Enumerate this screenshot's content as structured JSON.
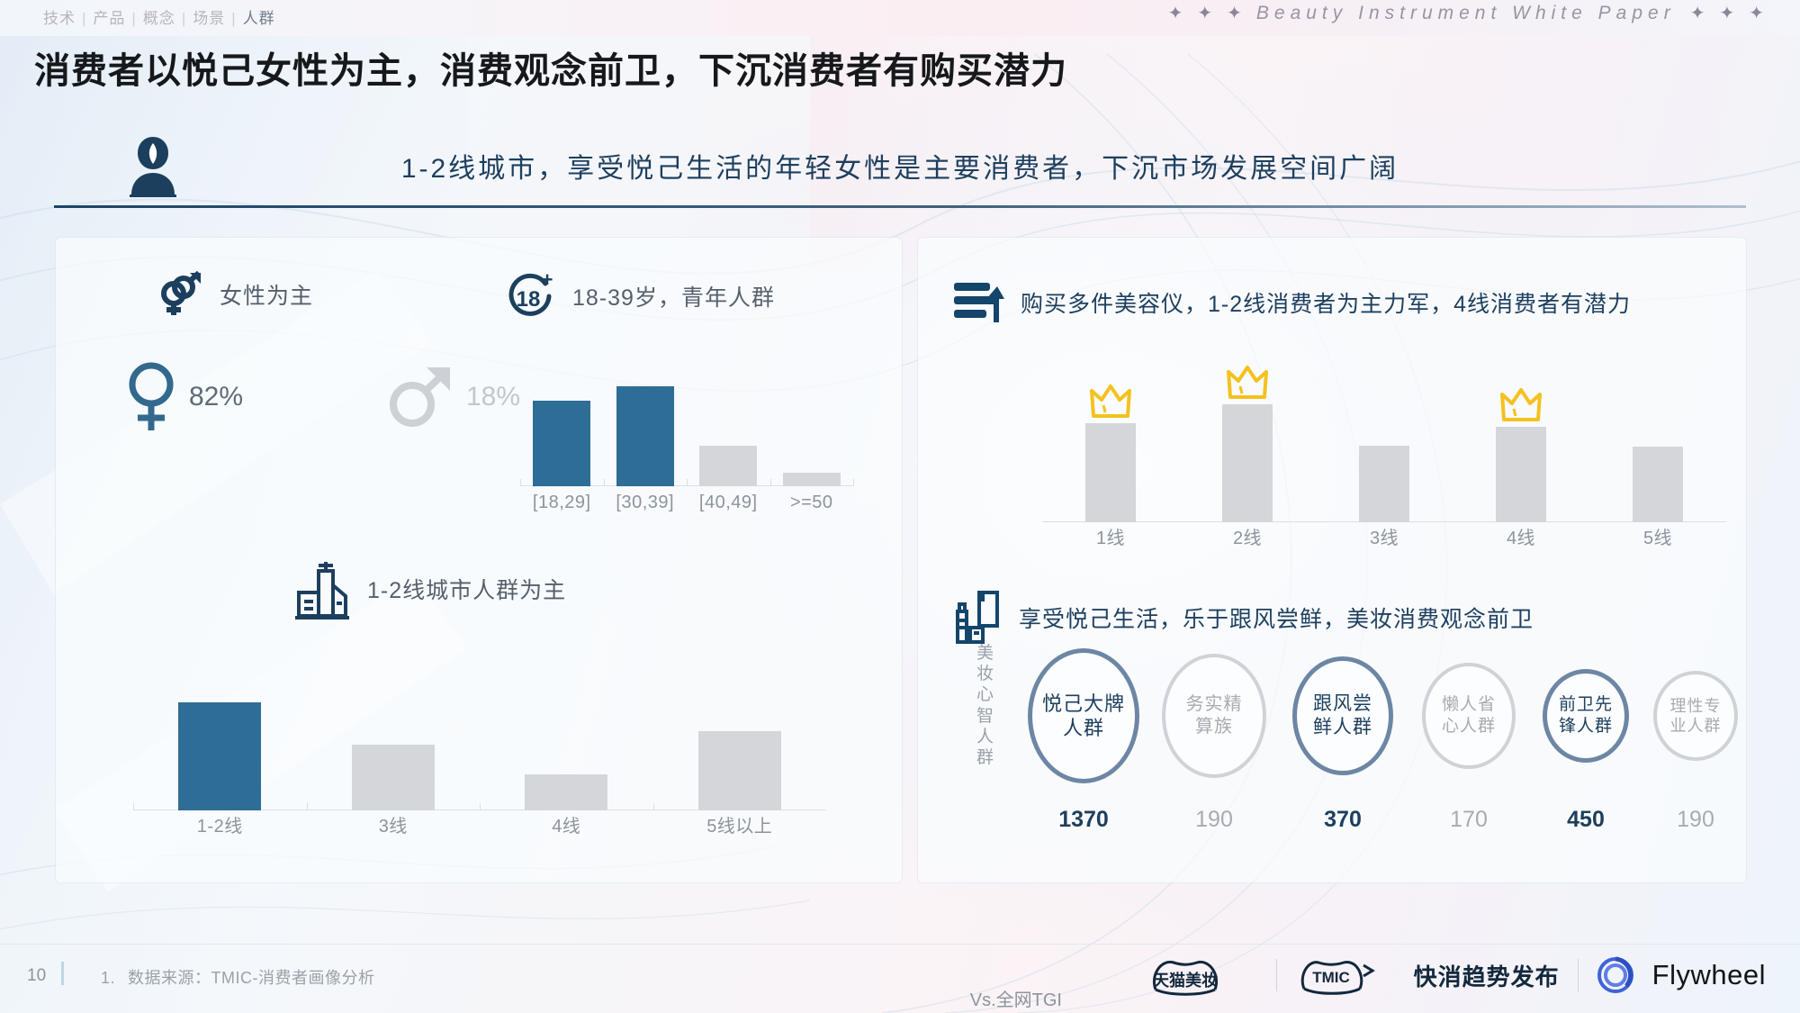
{
  "header": {
    "breadcrumb": [
      "技术",
      "产品",
      "概念",
      "场景",
      "人群"
    ],
    "breadcrumb_active_index": 4,
    "brandline": "Beauty Instrument White Paper",
    "spark_icon": "four-point-star",
    "title": "消费者以悦己女性为主，消费观念前卫，下沉消费者有购买潜力"
  },
  "banner": {
    "icon": "person-avatar-icon",
    "text": "1-2线城市，享受悦己生活的年轻女性是主要消费者，下沉市场发展空间广阔"
  },
  "left_panel": {
    "gender_row": {
      "icon": "gender-symbol-icon",
      "label": "女性为主"
    },
    "age_row": {
      "icon": "eighteen-plus-icon",
      "label": "18-39岁，青年人群"
    },
    "city_row": {
      "icon": "city-buildings-icon",
      "label": "1-2线城市人群为主"
    },
    "gender": {
      "female": {
        "icon": "female-symbol-icon",
        "value": "82%"
      },
      "male": {
        "icon": "male-symbol-icon",
        "value": "18%"
      }
    }
  },
  "right_panel": {
    "purchase_row": {
      "icon": "bar-up-arrow-icon",
      "label": "购买多件美容仪，1-2线消费者为主力军，4线消费者有潜力"
    },
    "mindset_row": {
      "icon": "cosmetics-bottles-icon",
      "label": "享受悦己生活，乐于跟风尝鲜，美妆消费观念前卫"
    },
    "tgi": {
      "vertical_label": "美妆心智人群",
      "axis_label": "Vs.全网TGI",
      "items": [
        {
          "name": "悦己大牌\n人群",
          "line1": "悦己大牌",
          "line2": "人群",
          "value": "1370",
          "highlight": true,
          "size": 150
        },
        {
          "name": "务实精算族",
          "line1": "务实精",
          "line2": "算族",
          "value": "190",
          "highlight": false,
          "size": 138
        },
        {
          "name": "跟风尝鲜人群",
          "line1": "跟风尝",
          "line2": "鲜人群",
          "value": "370",
          "highlight": true,
          "size": 132
        },
        {
          "name": "懒人省心人群",
          "line1": "懒人省",
          "line2": "心人群",
          "value": "170",
          "highlight": false,
          "size": 118
        },
        {
          "name": "前卫先锋人群",
          "line1": "前卫先",
          "line2": "锋人群",
          "value": "450",
          "highlight": true,
          "size": 104
        },
        {
          "name": "理性专业人群",
          "line1": "理性专",
          "line2": "业人群",
          "value": "190",
          "highlight": false,
          "size": 100
        }
      ]
    }
  },
  "footer": {
    "page_number": "10",
    "footnote_index": "1.",
    "footnote_text": "数据来源：TMIC-消费者画像分析",
    "logos": {
      "tmall_beauty": "天猫美妆",
      "tmic": "TMIC",
      "tmic_text": "快消趋势发布",
      "flywheel": "Flywheel"
    }
  },
  "colors": {
    "accent_blue": "#2e6d96",
    "deep_navy": "#1d3f5e",
    "bar_gray": "#d4d6da",
    "crown_yellow": "#f5c11f",
    "circle_blue": "#6d86a4",
    "circle_gray": "#cfd2d6"
  },
  "chart_data": [
    {
      "type": "bar",
      "title": "18-39岁，青年人群",
      "name": "age-distribution",
      "categories": [
        "[18,29]",
        "[30,39]",
        "[40,49]",
        ">=50"
      ],
      "values": [
        72,
        84,
        34,
        11
      ],
      "colors": [
        "#2e6d96",
        "#2e6d96",
        "#d4d6da",
        "#d4d6da"
      ],
      "ylim": [
        0,
        100
      ],
      "grid": false,
      "xlabel": "",
      "ylabel": ""
    },
    {
      "type": "bar",
      "title": "1-2线城市人群为主",
      "name": "city-tier-distribution",
      "categories": [
        "1-2线",
        "3线",
        "4线",
        "5线以上"
      ],
      "values": [
        87,
        42,
        26,
        47
      ],
      "colors": [
        "#2e6d96",
        "#d4d6da",
        "#d4d6da",
        "#d4d6da"
      ],
      "ylim": [
        0,
        100
      ],
      "grid": false,
      "xlabel": "",
      "ylabel": ""
    },
    {
      "type": "bar",
      "title": "购买多件美容仪，1-2线消费者为主力军，4线消费者有潜力",
      "name": "multi-purchase-by-city-tier",
      "categories": [
        "1线",
        "2线",
        "3线",
        "4线",
        "5线"
      ],
      "values": [
        78,
        88,
        59,
        76,
        58
      ],
      "colors": [
        "#d4d6da",
        "#d4d6da",
        "#d4d6da",
        "#d4d6da",
        "#d4d6da"
      ],
      "annotations": [
        {
          "category": "1线",
          "icon": "crown-icon"
        },
        {
          "category": "2线",
          "icon": "crown-icon"
        },
        {
          "category": "4线",
          "icon": "crown-icon"
        }
      ],
      "ylim": [
        0,
        100
      ],
      "grid": false,
      "xlabel": "",
      "ylabel": ""
    },
    {
      "type": "bar",
      "title": "享受悦己生活，乐于跟风尝鲜，美妆消费观念前卫",
      "name": "beauty-mindset-tgi",
      "categories": [
        "悦己大牌人群",
        "务实精算族",
        "跟风尝鲜人群",
        "懒人省心人群",
        "前卫先锋人群",
        "理性专业人群"
      ],
      "values": [
        1370,
        190,
        370,
        170,
        450,
        190
      ],
      "ylabel": "Vs.全网TGI",
      "xlabel": "美妆心智人群",
      "grid": false
    }
  ]
}
